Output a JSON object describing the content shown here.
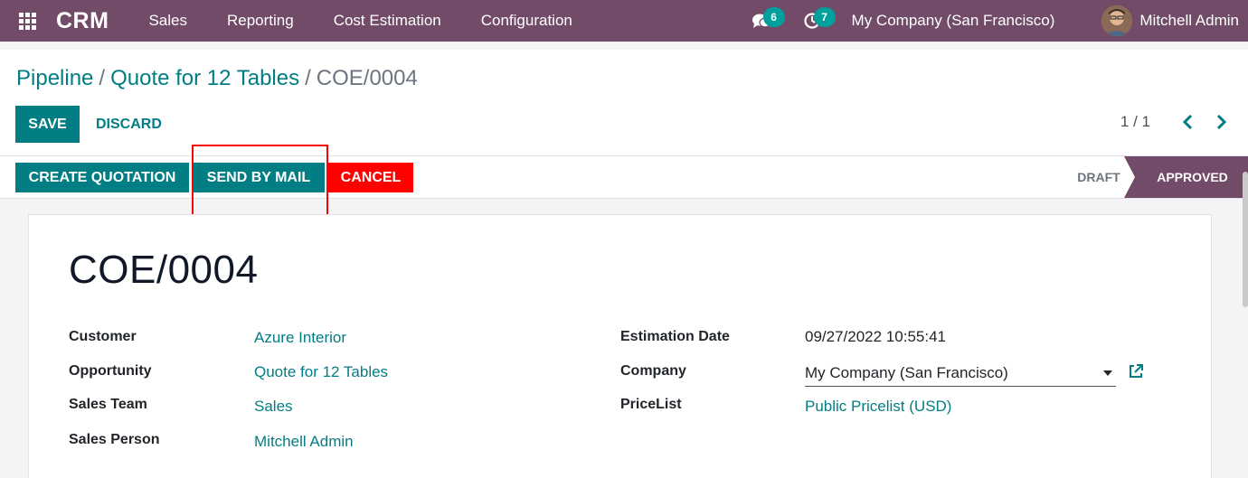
{
  "navbar": {
    "brand": "CRM",
    "menu": [
      "Sales",
      "Reporting",
      "Cost Estimation",
      "Configuration"
    ],
    "messages_count": "6",
    "activities_count": "7",
    "company": "My Company (San Francisco)",
    "user_name": "Mitchell Admin",
    "icons": {
      "apps": "apps-grid-icon",
      "messages": "chat-icon",
      "activities": "clock-icon"
    }
  },
  "breadcrumb": {
    "items": [
      "Pipeline",
      "Quote for 12 Tables"
    ],
    "current": "COE/0004"
  },
  "toolbar": {
    "save_label": "SAVE",
    "discard_label": "DISCARD",
    "pager": "1 / 1"
  },
  "statusbar": {
    "create_quotation_label": "CREATE QUOTATION",
    "send_mail_label": "SEND BY MAIL",
    "cancel_label": "CANCEL",
    "stages": [
      "DRAFT",
      "APPROVED"
    ],
    "active_stage": "APPROVED"
  },
  "form": {
    "title": "COE/0004",
    "left_fields": [
      {
        "label": "Customer",
        "value": "Azure Interior"
      },
      {
        "label": "Opportunity",
        "value": "Quote for 12 Tables"
      },
      {
        "label": "Sales Team",
        "value": "Sales"
      },
      {
        "label": "Sales Person",
        "value": "Mitchell Admin"
      }
    ],
    "right_fields": {
      "estimation_date_label": "Estimation Date",
      "estimation_date": "09/27/2022 10:55:41",
      "company_label": "Company",
      "company": "My Company (San Francisco)",
      "pricelist_label": "PriceList",
      "pricelist": "Public Pricelist (USD)"
    }
  },
  "colors": {
    "navbar": "#714b67",
    "primary": "#017e84",
    "danger": "#ff0000",
    "badge": "#00a09d"
  }
}
